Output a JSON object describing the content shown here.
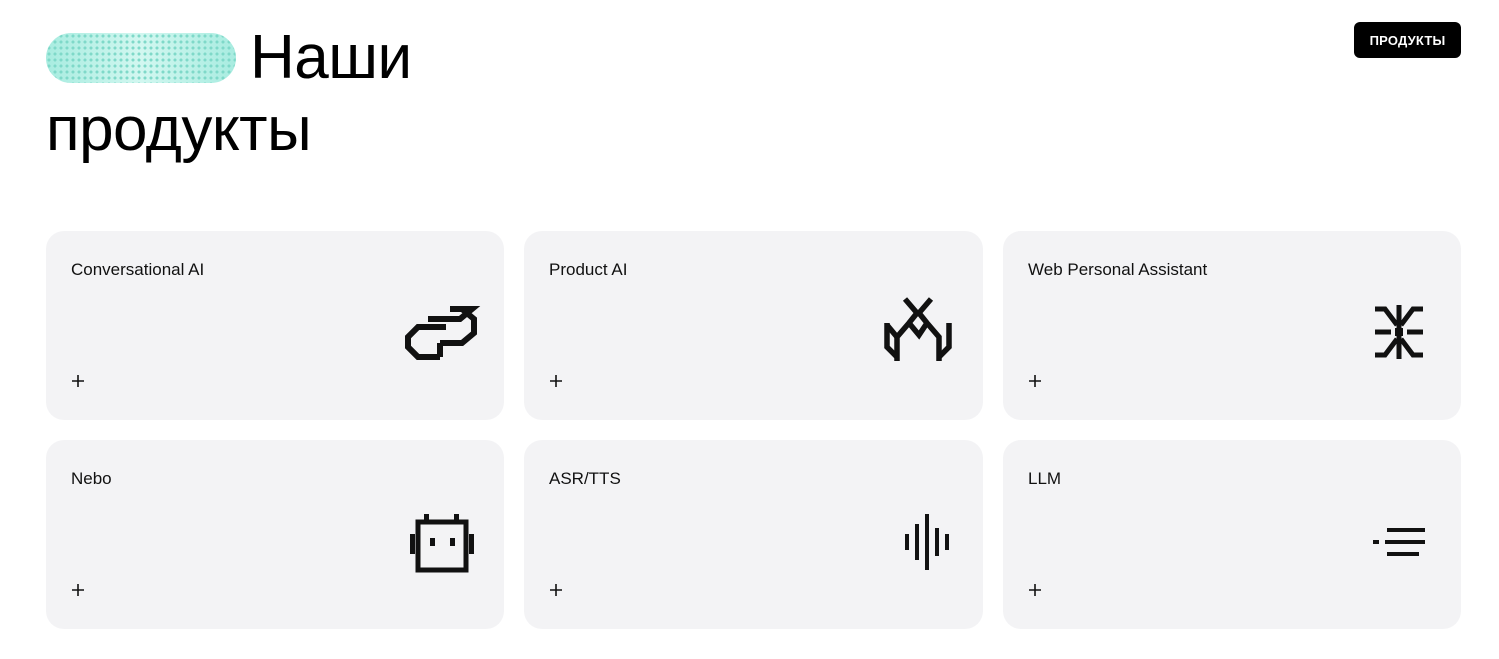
{
  "header": {
    "title_line1": "Наши",
    "title_line2": "продукты",
    "badge_label": "ПРОДУКТЫ"
  },
  "products": [
    {
      "title": "Conversational AI",
      "icon": "link-chain-icon",
      "action": "+"
    },
    {
      "title": "Product AI",
      "icon": "branching-y-icon",
      "action": "+"
    },
    {
      "title": "Web Personal Assistant",
      "icon": "asterisk-k-icon",
      "action": "+"
    },
    {
      "title": "Nebo",
      "icon": "robot-face-icon",
      "action": "+"
    },
    {
      "title": "ASR/TTS",
      "icon": "sound-wave-icon",
      "action": "+"
    },
    {
      "title": "LLM",
      "icon": "text-lines-icon",
      "action": "+"
    }
  ],
  "colors": {
    "card_background": "#f3f3f5",
    "badge_background": "#000000",
    "pill_accent": "#bff2e8"
  }
}
